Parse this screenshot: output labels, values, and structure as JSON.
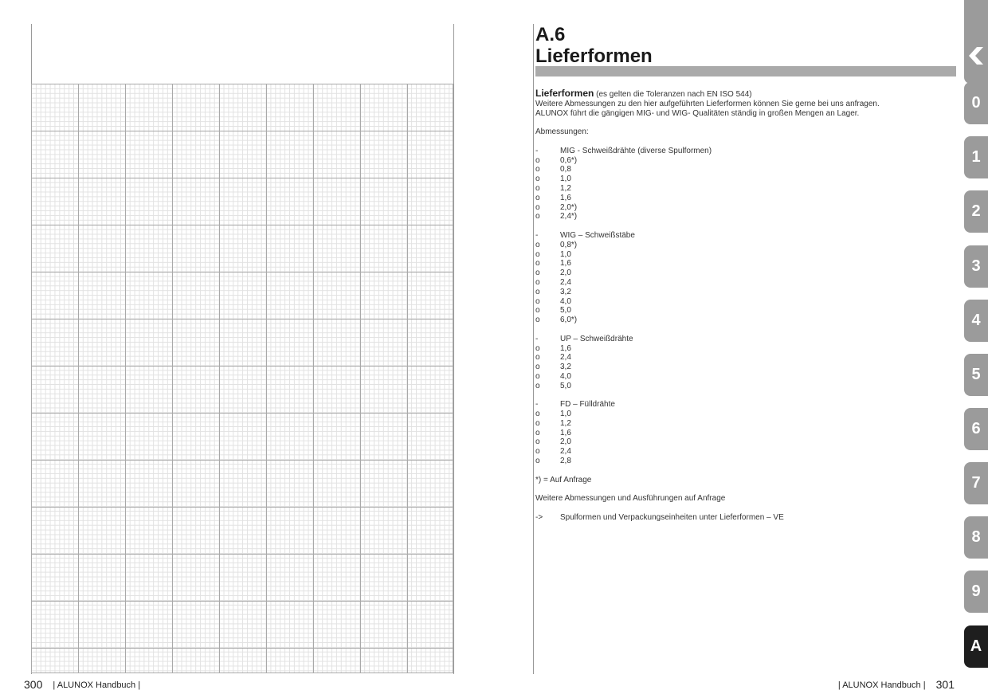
{
  "left_page": {
    "page_number": "300",
    "footer_text": "| ALUNOX Handbuch |"
  },
  "right_page": {
    "heading": {
      "line1": "A.6",
      "line2": "Lieferformen"
    },
    "intro": {
      "title": "Lieferformen",
      "title_note": "(es gelten die Toleranzen nach EN ISO 544)",
      "line2": "Weitere Abmessungen zu den hier aufgeführten Lieferformen können Sie gerne bei uns anfragen.",
      "line3": "ALUNOX führt die gängigen MIG- und WIG- Qualitäten ständig in großen Mengen an Lager."
    },
    "dimensions_label": "Abmessungen:",
    "groups": [
      {
        "marker": "-",
        "title": "MIG - Schweißdrähte (diverse Spulformen)",
        "item_marker": "o",
        "items": [
          "0,6*)",
          "0,8",
          "1,0",
          "1,2",
          "1,6",
          "2,0*)",
          "2,4*)"
        ]
      },
      {
        "marker": "-",
        "title": "WIG – Schweißstäbe",
        "item_marker": "o",
        "items": [
          "0,8*)",
          "1,0",
          "1,6",
          "2,0",
          "2,4",
          "3,2",
          "4,0",
          "5,0",
          "6,0*)"
        ]
      },
      {
        "marker": "-",
        "title": "UP – Schweißdrähte",
        "item_marker": "o",
        "items": [
          "1,6",
          "2,4",
          "3,2",
          "4,0",
          "5,0"
        ]
      },
      {
        "marker": "-",
        "title": "FD – Fülldrähte",
        "item_marker": "o",
        "items": [
          "1,0",
          "1,2",
          "1,6",
          "2,0",
          "2,4",
          "2,8"
        ]
      }
    ],
    "footnote": "*) = Auf Anfrage",
    "more_text": "Weitere Abmessungen und Ausführungen auf Anfrage",
    "reference": {
      "marker": "->",
      "text": "Spulformen und Verpackungseinheiten unter Lieferformen – VE"
    },
    "page_number": "301",
    "footer_text": "| ALUNOX Handbuch |"
  },
  "side_tabs": {
    "logo_icon": "alunox-logo-icon",
    "items": [
      "0",
      "1",
      "2",
      "3",
      "4",
      "5",
      "6",
      "7",
      "8",
      "9",
      "A"
    ],
    "active": "A"
  },
  "colors": {
    "heading_bar": "#aaaaaa",
    "tab_gray": "#9b9b9b",
    "tab_active": "#1e1e1e"
  }
}
